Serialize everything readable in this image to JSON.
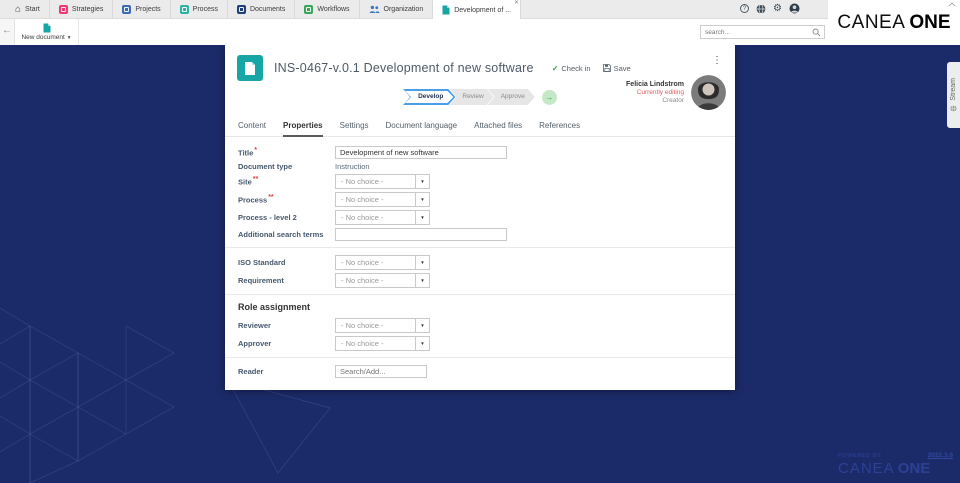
{
  "topbar": {
    "tabs": [
      {
        "label": "Start"
      },
      {
        "label": "Strategies"
      },
      {
        "label": "Projects"
      },
      {
        "label": "Process"
      },
      {
        "label": "Documents"
      },
      {
        "label": "Workflows"
      },
      {
        "label": "Organization"
      },
      {
        "label": "Development of ..."
      }
    ],
    "logo": {
      "word1": "CANEA",
      "word2": "ONE"
    }
  },
  "toolbar": {
    "new_document": "New document",
    "search_placeholder": "search..."
  },
  "doc_header": {
    "title": "INS-0467-v.0.1 Development of new software",
    "check_in": "Check in",
    "save": "Save"
  },
  "workflow": {
    "steps": [
      "Develop",
      "Review",
      "Approve"
    ]
  },
  "user_panel": {
    "name": "Felicia Lindstrom",
    "status": "Currently editing",
    "role": "Creator"
  },
  "content_tabs": [
    "Content",
    "Properties",
    "Settings",
    "Document language",
    "Attached files",
    "References"
  ],
  "form": {
    "title": {
      "label": "Title",
      "required": "*",
      "value": "Development of new software"
    },
    "document_type": {
      "label": "Document type",
      "value": "Instruction"
    },
    "site": {
      "label": "Site",
      "required": "**",
      "placeholder": "- No choice -"
    },
    "process": {
      "label": "Process",
      "required": "**",
      "placeholder": "- No choice -"
    },
    "process_level2": {
      "label": "Process - level 2",
      "placeholder": "- No choice -"
    },
    "additional_search_terms": {
      "label": "Additional search terms",
      "value": ""
    },
    "iso_standard": {
      "label": "ISO Standard",
      "placeholder": "- No choice -"
    },
    "requirement": {
      "label": "Requirement",
      "placeholder": "- No choice -"
    },
    "role_assignment_heading": "Role assignment",
    "reviewer": {
      "label": "Reviewer",
      "placeholder": "- No choice -"
    },
    "approver": {
      "label": "Approver",
      "placeholder": "- No choice -"
    },
    "reader": {
      "label": "Reader",
      "placeholder": "Search/Add..."
    }
  },
  "stream": {
    "label": "Stream"
  },
  "footer": {
    "powered_by": "POWERED BY",
    "brand1": "CANEA",
    "brand2": "ONE",
    "version": "2022.3.6"
  },
  "colors": {
    "brand_teal": "#17a5a5",
    "navy_background": "#1b2b69",
    "active_step_blue": "#4a9fe8",
    "success_green": "#43a047",
    "editing_red": "#e05c5c",
    "strategies_pink": "#ed3a72",
    "projects_blue": "#3a6ab8",
    "process_teal": "#2db3a6",
    "documents_navy": "#1f3f7d",
    "workflows_green": "#3ba55c",
    "organization_blue": "#3c79c2"
  }
}
